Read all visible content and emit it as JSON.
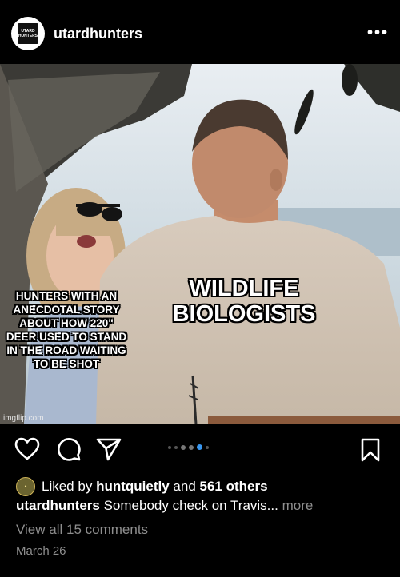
{
  "header": {
    "username": "utardhunters",
    "avatar_text_1": "UTARD",
    "avatar_text_2": "HUNTERS",
    "more_label": "•••"
  },
  "post": {
    "meme_left_text": "HUNTERS WITH AN ANECDOTAL STORY ABOUT HOW 220\" DEER USED TO STAND IN THE ROAD WAITING TO BE SHOT",
    "meme_right_text": "WILDLIFE BIOLOGISTS",
    "watermark": "imgflip.com"
  },
  "actions": {
    "like_icon": "heart-icon",
    "comment_icon": "comment-bubble-icon",
    "share_icon": "paper-plane-icon",
    "save_icon": "bookmark-icon",
    "carousel_count": 5,
    "carousel_active_index": 3,
    "accent_color": "#3897f0"
  },
  "likes": {
    "prefix": "Liked by",
    "user": "huntquietly",
    "middle": "and",
    "others": "561 others"
  },
  "caption": {
    "username": "utardhunters",
    "text": "Somebody check on Travis...",
    "more": "more"
  },
  "comments_label": "View all 15 comments",
  "date": "March 26"
}
